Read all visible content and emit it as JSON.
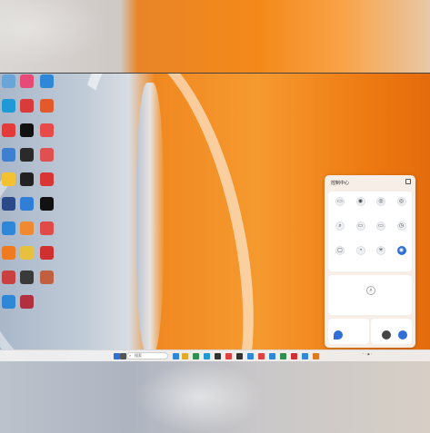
{
  "desktop": {
    "icons": [
      {
        "name": "recycle-bin-icon",
        "color": "#6aa5d8",
        "label": ""
      },
      {
        "name": "app-icon-1",
        "color": "#e84a77",
        "label": ""
      },
      {
        "name": "app-icon-2",
        "color": "#2f87d8",
        "label": ""
      },
      {
        "name": "edge-icon",
        "color": "#1f9ad6",
        "label": ""
      },
      {
        "name": "app-icon-3",
        "color": "#d93a3a",
        "label": ""
      },
      {
        "name": "app-icon-4",
        "color": "#e25a2b",
        "label": ""
      },
      {
        "name": "app-icon-5",
        "color": "#e33a3a",
        "label": ""
      },
      {
        "name": "capcut-icon",
        "color": "#111111",
        "label": ""
      },
      {
        "name": "app-icon-6",
        "color": "#e84a4a",
        "label": ""
      },
      {
        "name": "app-icon-7",
        "color": "#3f7fd0",
        "label": ""
      },
      {
        "name": "app-icon-8",
        "color": "#2a2a2a",
        "label": ""
      },
      {
        "name": "app-icon-9",
        "color": "#e05050",
        "label": ""
      },
      {
        "name": "app-icon-10",
        "color": "#f2c230",
        "label": ""
      },
      {
        "name": "app-icon-11",
        "color": "#222222",
        "label": ""
      },
      {
        "name": "app-icon-12",
        "color": "#d93535",
        "label": ""
      },
      {
        "name": "app-icon-13",
        "color": "#2b4a8a",
        "label": ""
      },
      {
        "name": "app-icon-14",
        "color": "#2f7fd8",
        "label": ""
      },
      {
        "name": "tiktok-icon",
        "color": "#111111",
        "label": ""
      },
      {
        "name": "app-icon-15",
        "color": "#2f87d8",
        "label": ""
      },
      {
        "name": "app-icon-16",
        "color": "#f08a30",
        "label": ""
      },
      {
        "name": "app-icon-17",
        "color": "#e24a4a",
        "label": ""
      },
      {
        "name": "app-icon-18",
        "color": "#f07a20",
        "label": ""
      },
      {
        "name": "app-icon-19",
        "color": "#e8c040",
        "label": ""
      },
      {
        "name": "app-icon-20",
        "color": "#d03030",
        "label": ""
      },
      {
        "name": "app-icon-21",
        "color": "#c84040",
        "label": ""
      },
      {
        "name": "app-icon-22",
        "color": "#3a3a3a",
        "label": ""
      },
      {
        "name": "app-icon-23",
        "color": "#c06040",
        "label": ""
      },
      {
        "name": "app-icon-24",
        "color": "#2f87d8",
        "label": ""
      },
      {
        "name": "app-icon-25",
        "color": "#b03040",
        "label": ""
      }
    ]
  },
  "control_center": {
    "title": "控制中心",
    "tiles": [
      {
        "name": "tile-1",
        "glyph": "▭",
        "on": false
      },
      {
        "name": "tile-2",
        "glyph": "◉",
        "on": false
      },
      {
        "name": "tile-3",
        "glyph": "◎",
        "on": false
      },
      {
        "name": "tile-4",
        "glyph": "◎",
        "on": false
      },
      {
        "name": "tile-5",
        "glyph": "⌕",
        "on": false
      },
      {
        "name": "tile-6",
        "glyph": "▭",
        "on": false
      },
      {
        "name": "tile-7",
        "glyph": "▭",
        "on": false
      },
      {
        "name": "tile-8",
        "glyph": "◷",
        "on": false
      },
      {
        "name": "tile-9",
        "glyph": "▢",
        "on": false
      },
      {
        "name": "tile-10",
        "glyph": "◔",
        "on": false
      },
      {
        "name": "tile-11",
        "glyph": "✳",
        "on": false
      },
      {
        "name": "tile-12",
        "glyph": "◉",
        "on": true
      }
    ],
    "section": {
      "title": "",
      "glyph": "⌕",
      "desc": ""
    },
    "bottom_left": {
      "title": "",
      "color": "#2f6fd6"
    },
    "bottom_right": {
      "title": "",
      "color": "#444444"
    }
  },
  "taskbar": {
    "weather": "",
    "search_placeholder": "搜索",
    "search_glyph": "⌕",
    "clock_time": "",
    "clock_date": "",
    "buttons": [
      {
        "name": "start-button",
        "color": "#2f6fd6"
      },
      {
        "name": "task-view-button",
        "color": "#555555"
      },
      {
        "name": "taskbar-app-1",
        "color": "#2f87d8"
      },
      {
        "name": "taskbar-app-2",
        "color": "#e2a92a"
      },
      {
        "name": "taskbar-app-3",
        "color": "#2f8f4f"
      },
      {
        "name": "taskbar-app-4",
        "color": "#1f9ad6"
      },
      {
        "name": "taskbar-app-5",
        "color": "#333333"
      },
      {
        "name": "taskbar-app-6",
        "color": "#e04040"
      },
      {
        "name": "taskbar-app-7",
        "color": "#333333"
      },
      {
        "name": "taskbar-app-8",
        "color": "#2f87d8"
      },
      {
        "name": "taskbar-app-9",
        "color": "#e04040"
      },
      {
        "name": "taskbar-app-10",
        "color": "#2f87d8"
      },
      {
        "name": "taskbar-app-11",
        "color": "#2f8f4f"
      },
      {
        "name": "taskbar-app-12",
        "color": "#d03030"
      },
      {
        "name": "taskbar-app-13",
        "color": "#2f87d8"
      },
      {
        "name": "taskbar-app-14",
        "color": "#e07a20"
      }
    ]
  }
}
